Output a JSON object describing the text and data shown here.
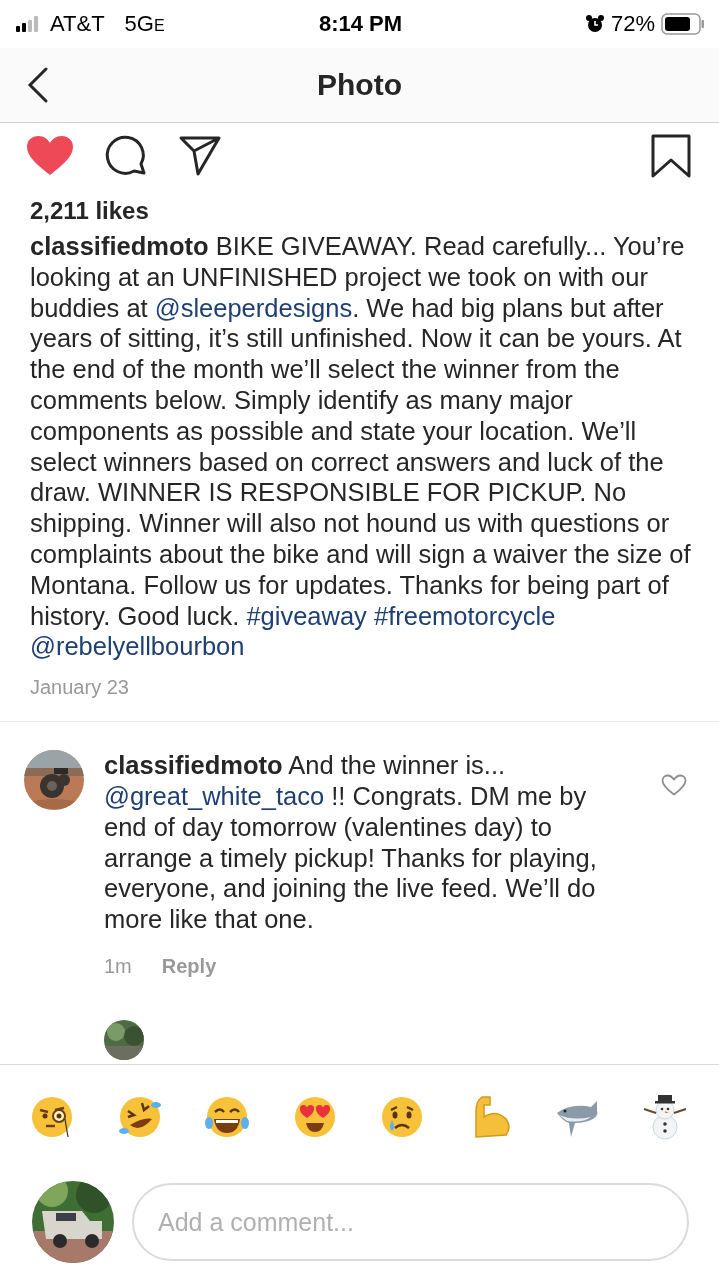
{
  "status_bar": {
    "carrier": "AT&T",
    "network": "5G",
    "network_suffix": "E",
    "time": "8:14 PM",
    "battery_percent": "72%"
  },
  "nav": {
    "title": "Photo"
  },
  "post": {
    "liked": true,
    "saved": false,
    "likes": "2,211 likes",
    "date": "January 23",
    "caption": [
      {
        "kind": "bold",
        "text": "classifiedmoto"
      },
      {
        "kind": "text",
        "text": " BIKE GIVEAWAY. Read carefully... You’re looking at an UNFINISHED project we took on with our buddies at "
      },
      {
        "kind": "mention",
        "text": "@sleeperdesigns"
      },
      {
        "kind": "text",
        "text": ". We had big plans but after years of sitting, it’s still unfinished. Now it can be yours. At the end of the month we’ll select the winner from the comments below. Simply identify as many major components as possible and state your location. We’ll select winners based on correct answers and luck of the draw. WINNER IS RESPONSIBLE FOR PICKUP. No shipping. Winner will also not hound us with questions or complaints about the bike and will sign a waiver the size of Montana. Follow us for updates. Thanks for being part of history. Good luck. "
      },
      {
        "kind": "hashtag",
        "text": "#giveaway"
      },
      {
        "kind": "hashtag",
        "text": "#freemotorcycle"
      },
      {
        "kind": "mention",
        "text": "@rebelyellbourbon"
      }
    ]
  },
  "comments": [
    {
      "liked": false,
      "time": "1m",
      "reply": "Reply",
      "body": [
        {
          "kind": "bold",
          "text": "classifiedmoto"
        },
        {
          "kind": "text",
          "text": " And the winner is... "
        },
        {
          "kind": "mention",
          "text": "@great_white_taco"
        },
        {
          "kind": "text",
          "text": " !! Congrats. DM me by end of day tomorrow (valentines day) to arrange a timely pickup! Thanks for playing, everyone, and joining the live feed. We’ll do more like that one."
        }
      ]
    }
  ],
  "composer": {
    "placeholder": "Add a comment..."
  }
}
